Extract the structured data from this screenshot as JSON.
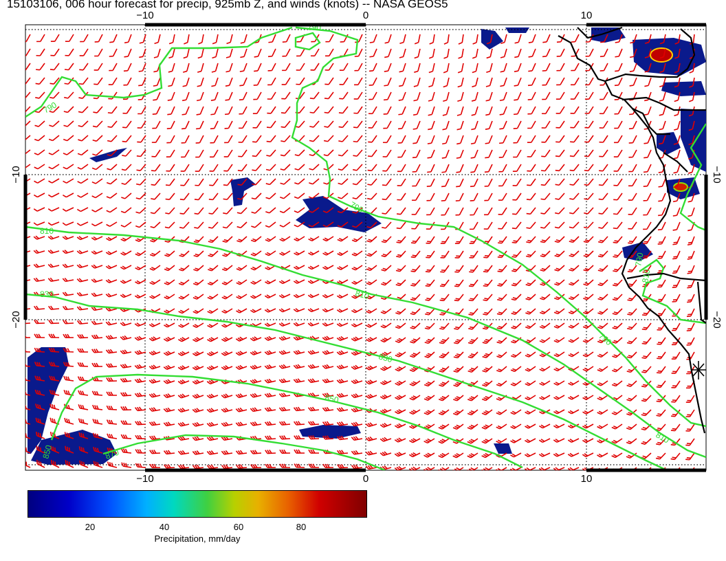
{
  "title": "15103106, 006 hour forecast for precip, 925mb Z, and winds (knots) -- NASA GEOS5",
  "axes": {
    "lon_ticks": [
      "−10",
      "0",
      "10"
    ],
    "lat_ticks": [
      "−10",
      "−20"
    ]
  },
  "contours": [
    {
      "label": "790"
    },
    {
      "label": "810"
    },
    {
      "label": "830"
    },
    {
      "label": "850"
    },
    {
      "label": "870"
    }
  ],
  "colorbar": {
    "title": "Precipitation, mm/day",
    "ticks": [
      "20",
      "40",
      "60",
      "80"
    ]
  },
  "colors": {
    "contour": "#33dd33",
    "wind": "#e00000",
    "precip_low": "#0a1a8c",
    "precip_high": "#8b0000"
  }
}
